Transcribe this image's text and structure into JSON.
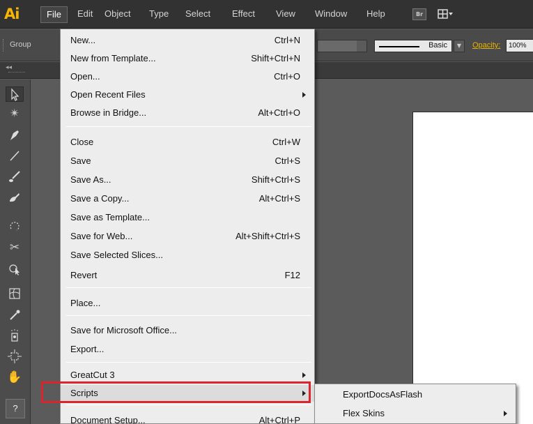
{
  "app": {
    "logo": "Ai"
  },
  "menubar": {
    "items": [
      {
        "label": "File"
      },
      {
        "label": "Edit"
      },
      {
        "label": "Object"
      },
      {
        "label": "Type"
      },
      {
        "label": "Select"
      },
      {
        "label": "Effect"
      },
      {
        "label": "View"
      },
      {
        "label": "Window"
      },
      {
        "label": "Help"
      }
    ],
    "bridge_button": "Br",
    "arrange_icon": "arrange-documents-icon"
  },
  "controlbar": {
    "group_label": "Group",
    "stroke_profile": "Basic",
    "opacity_label": "Opacity:",
    "opacity_value": "100%"
  },
  "tools": [
    {
      "icon": "selection-arrow-icon"
    },
    {
      "icon": "magic-wand-icon"
    },
    {
      "icon": "pen-icon"
    },
    {
      "icon": "line-segment-icon"
    },
    {
      "icon": "paintbrush-icon"
    },
    {
      "icon": "blob-brush-icon"
    },
    {
      "icon": "rotate-icon"
    },
    {
      "icon": "warp-icon"
    },
    {
      "icon": "shape-builder-icon"
    },
    {
      "icon": "mesh-icon"
    },
    {
      "icon": "eyedropper-icon"
    },
    {
      "icon": "symbol-sprayer-icon"
    },
    {
      "icon": "artboard-icon"
    },
    {
      "icon": "hand-icon"
    }
  ],
  "help_button": "?",
  "file_menu": {
    "items": [
      {
        "label": "New...",
        "shortcut": "Ctrl+N"
      },
      {
        "label": "New from Template...",
        "shortcut": "Shift+Ctrl+N"
      },
      {
        "label": "Open...",
        "shortcut": "Ctrl+O"
      },
      {
        "label": "Open Recent Files",
        "shortcut": "",
        "submenu": true
      },
      {
        "label": "Browse in Bridge...",
        "shortcut": "Alt+Ctrl+O"
      },
      {
        "label": "Close",
        "shortcut": "Ctrl+W"
      },
      {
        "label": "Save",
        "shortcut": "Ctrl+S"
      },
      {
        "label": "Save As...",
        "shortcut": "Shift+Ctrl+S"
      },
      {
        "label": "Save a Copy...",
        "shortcut": "Alt+Ctrl+S"
      },
      {
        "label": "Save as Template...",
        "shortcut": ""
      },
      {
        "label": "Save for Web...",
        "shortcut": "Alt+Shift+Ctrl+S"
      },
      {
        "label": "Save Selected Slices...",
        "shortcut": ""
      },
      {
        "label": "Revert",
        "shortcut": "F12"
      },
      {
        "label": "Place...",
        "shortcut": ""
      },
      {
        "label": "Save for Microsoft Office...",
        "shortcut": ""
      },
      {
        "label": "Export...",
        "shortcut": ""
      },
      {
        "label": "GreatCut 3",
        "shortcut": "",
        "submenu": true
      },
      {
        "label": "Scripts",
        "shortcut": "",
        "submenu": true,
        "highlighted": true
      },
      {
        "label": "Document Setup...",
        "shortcut": "Alt+Ctrl+P"
      }
    ]
  },
  "scripts_submenu": {
    "items": [
      {
        "label": "ExportDocsAsFlash"
      },
      {
        "label": "Flex Skins",
        "submenu": true
      }
    ]
  },
  "colors": {
    "accent_logo": "#f7b500",
    "highlight_border": "#d9252b",
    "menu_bg": "#ededed",
    "ui_dark": "#323232"
  }
}
